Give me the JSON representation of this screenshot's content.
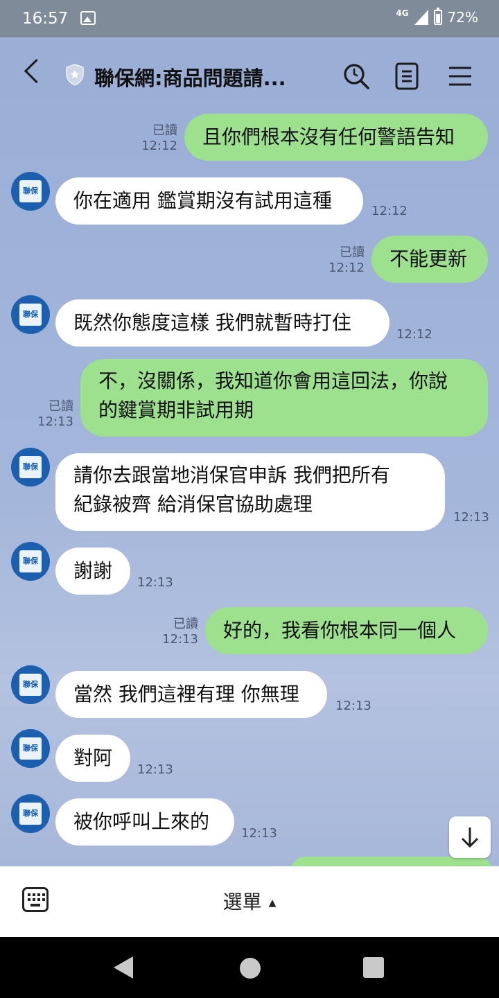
{
  "status_bar": {
    "time": "16:57",
    "network": "4G",
    "battery": "72%"
  },
  "header": {
    "title": "聯保網:商品問題請..."
  },
  "avatar_label": "聯保",
  "messages": [
    {
      "dir": "out",
      "text": "且你們根本沒有任何警語告知",
      "read": "已讀",
      "time": "12:12"
    },
    {
      "dir": "in",
      "text": "你在適用 鑑賞期沒有試用這種",
      "time": "12:12"
    },
    {
      "dir": "out",
      "text": "不能更新",
      "read": "已讀",
      "time": "12:12"
    },
    {
      "dir": "in",
      "text": "既然你態度這樣 我們就暫時打住",
      "time": "12:12"
    },
    {
      "dir": "out",
      "lines": [
        "不，沒關係，我知道你會用這回法，你說",
        "的鍵賞期非試用期"
      ],
      "read": "已讀",
      "time": "12:13"
    },
    {
      "dir": "in",
      "lines": [
        "請你去跟當地消保官申訴 我們把所有",
        "紀錄被齊  給消保官協助處理"
      ],
      "time": "12:13"
    },
    {
      "dir": "in",
      "text": "謝謝",
      "time": "12:13"
    },
    {
      "dir": "out",
      "text": "好的，我看你根本同一個人",
      "read": "已讀",
      "time": "12:13"
    },
    {
      "dir": "in",
      "text": "當然 我們這裡有理 你無理",
      "time": "12:13"
    },
    {
      "dir": "in",
      "text": "對阿",
      "time": "12:13"
    },
    {
      "dir": "in",
      "text": "被你呼叫上來的",
      "time": "12:13"
    }
  ],
  "bottom_bar": {
    "menu_label": "選單"
  }
}
